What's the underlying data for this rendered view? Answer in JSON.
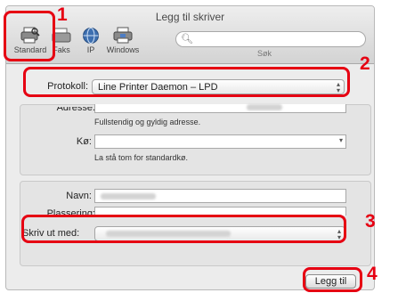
{
  "window": {
    "title": "Legg til skriver"
  },
  "toolbar": {
    "items": [
      {
        "label": "Standard",
        "icon": "printer-search-icon"
      },
      {
        "label": "Faks",
        "icon": "fax-icon"
      },
      {
        "label": "IP",
        "icon": "globe-icon"
      },
      {
        "label": "Windows",
        "icon": "windows-printer-icon"
      }
    ],
    "search_label": "Søk",
    "search_icon": "magnifier-icon"
  },
  "form": {
    "protocol_label": "Protokoll:",
    "protocol_value": "Line Printer Daemon – LPD",
    "address_label": "Adresse:",
    "address_help": "Fullstendig og gyldig adresse.",
    "queue_label": "Kø:",
    "queue_help": "La stå tom for standardkø.",
    "name_label": "Navn:",
    "location_label": "Plassering:",
    "print_with_label": "Skriv ut med:"
  },
  "buttons": {
    "add_label": "Legg til"
  },
  "callouts": {
    "c1": "1",
    "c2": "2",
    "c3": "3",
    "c4": "4"
  },
  "colors": {
    "callout": "#e60012"
  }
}
